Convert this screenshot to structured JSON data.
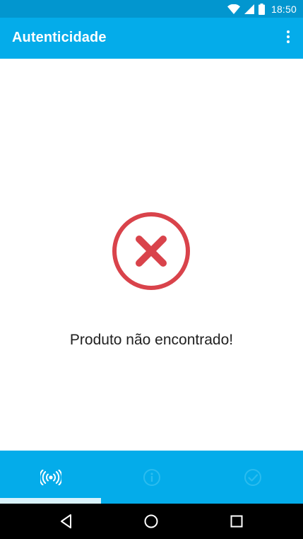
{
  "status_bar": {
    "time": "18:50",
    "icons": [
      "wifi-icon",
      "cell-signal-icon",
      "battery-icon"
    ]
  },
  "app_bar": {
    "title": "Autenticidade",
    "menu_icon": "overflow-menu-icon"
  },
  "content": {
    "result_icon": "error-x-circle-icon",
    "message": "Produto não encontrado!"
  },
  "bottom_nav": {
    "tabs": [
      {
        "icon": "nfc-scan-icon",
        "selected": true
      },
      {
        "icon": "info-icon",
        "selected": false
      },
      {
        "icon": "check-circle-icon",
        "selected": false
      }
    ]
  },
  "system_nav": {
    "buttons": [
      "back-icon",
      "home-icon",
      "recents-icon"
    ]
  },
  "colors": {
    "status_bar": "#0296cf",
    "primary": "#04acea",
    "error": "#d9434b",
    "tab_indicator": "#d8f2fb",
    "text": "#212121"
  }
}
